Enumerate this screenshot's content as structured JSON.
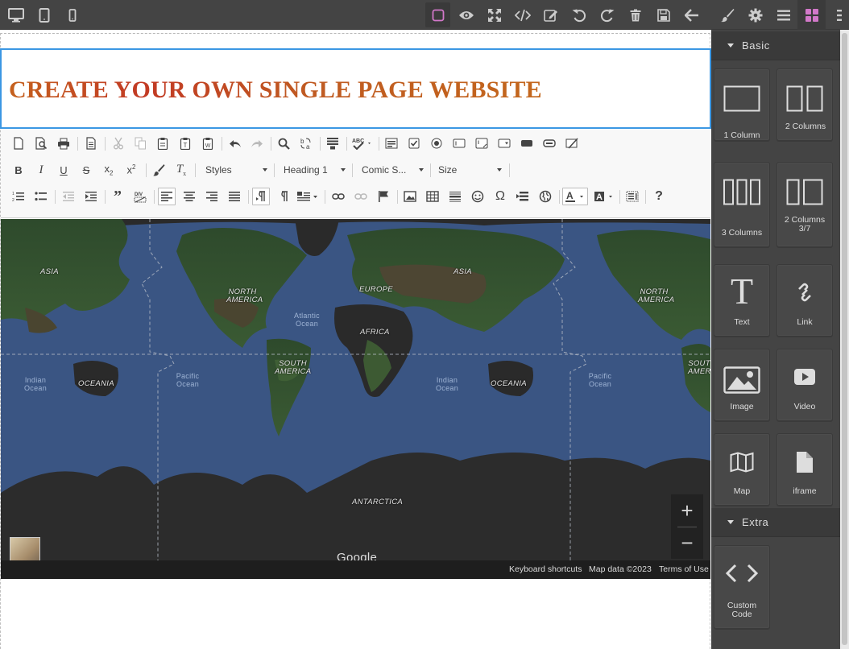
{
  "topbar": {
    "devices": [
      "desktop-icon",
      "tablet-icon",
      "mobile-icon"
    ],
    "options": [
      "sw-visibility-icon",
      "preview-icon",
      "fullscreen-icon",
      "code-icon",
      "edit-icon",
      "undo-icon",
      "redo-icon",
      "trash-icon",
      "save-icon",
      "back-arrow-icon"
    ],
    "views": [
      "style-manager-icon",
      "settings-icon",
      "layer-manager-icon",
      "blocks-icon"
    ],
    "accent_color": "#d278c9"
  },
  "page": {
    "heading": "CREATE YOUR OWN SINGLE PAGE WEBSITE",
    "heading_color": "#c4571f",
    "selected_border_color": "#3b97e3"
  },
  "editor_toolbar": {
    "styles_label": "Styles",
    "format_label": "Heading 1",
    "font_label": "Comic S...",
    "size_label": "Size"
  },
  "map": {
    "labels": {
      "asia_1": "ASIA",
      "asia_2": "ASIA",
      "north_america_1": "NORTH AMERICA",
      "north_america_2": "NORTH AMERICA",
      "europe": "EUROPE",
      "africa": "AFRICA",
      "atlantic": "Atlantic Ocean",
      "south_america_1": "SOUTH AMERICA",
      "south_america_2": "SOUT AMER",
      "indian_1": "Indian Ocean",
      "indian_2": "Indian Ocean",
      "oceania_1": "OCEANIA",
      "oceania_2": "OCEANIA",
      "pacific_1": "Pacific Ocean",
      "pacific_2": "Pacific Ocean",
      "antarctica": "ANTARCTICA"
    },
    "zoom_in": "+",
    "zoom_out": "−",
    "google": "Google",
    "footer": {
      "shortcuts": "Keyboard shortcuts",
      "map_data": "Map data ©2023",
      "terms": "Terms of Use"
    }
  },
  "panel": {
    "categories": {
      "basic": "Basic",
      "extra": "Extra"
    },
    "blocks": {
      "col1": "1 Column",
      "col2": "2 Columns",
      "col3": "3 Columns",
      "col37": "2 Columns 3/7",
      "text": "Text",
      "link": "Link",
      "image": "Image",
      "video": "Video",
      "map": "Map",
      "iframe": "iframe",
      "custom_code": "Custom Code"
    },
    "icons": {
      "text_icon": "T"
    }
  }
}
